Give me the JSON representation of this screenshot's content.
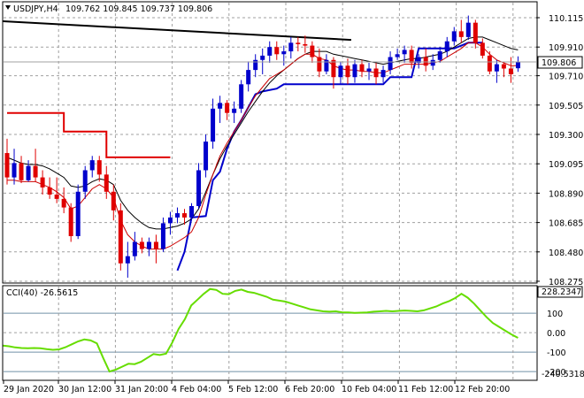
{
  "header": {
    "symbol": "USDJPY,H4",
    "ohlc": "109.762 109.845 109.737 109.806"
  },
  "cci_header": "CCI(40) -26.5615",
  "price_badge": "109.806",
  "cci_top_badge": "228.2347",
  "cci_bottom_badge": "-240.5318",
  "colors": {
    "bull": "#0000cc",
    "bear": "#e00000",
    "ma_fast": "#cc0000",
    "ma_slow": "#000000",
    "trend": "#000000",
    "stop_red": "#e00000",
    "stop_blue": "#0000cc",
    "cci": "#66dd00"
  },
  "chart_data": [
    {
      "type": "candlestick",
      "title": "USDJPY,H4",
      "ylim": [
        108.275,
        110.24
      ],
      "y_ticks": [
        "110.115",
        "109.910",
        "109.710",
        "109.505",
        "109.300",
        "109.095",
        "108.890",
        "108.685",
        "108.480",
        "108.275"
      ],
      "x_ticks": [
        "29 Jan 2020",
        "30 Jan 12:00",
        "31 Jan 20:00",
        "4 Feb 04:00",
        "5 Feb 12:00",
        "6 Feb 20:00",
        "10 Feb 04:00",
        "11 Feb 12:00",
        "12 Feb 20:00"
      ],
      "current_price": 109.806,
      "candles": [
        [
          109.17,
          109.27,
          108.95,
          109.0
        ],
        [
          109.0,
          109.2,
          108.95,
          109.1
        ],
        [
          109.1,
          109.15,
          108.96,
          108.98
        ],
        [
          108.98,
          109.12,
          108.97,
          109.08
        ],
        [
          109.08,
          109.2,
          108.97,
          109.0
        ],
        [
          109.0,
          109.05,
          108.88,
          108.93
        ],
        [
          108.93,
          109.0,
          108.85,
          108.88
        ],
        [
          108.88,
          109.0,
          108.82,
          108.85
        ],
        [
          108.85,
          108.93,
          108.75,
          108.79
        ],
        [
          108.79,
          108.82,
          108.55,
          108.59
        ],
        [
          108.59,
          108.95,
          108.57,
          108.9
        ],
        [
          108.9,
          109.08,
          108.85,
          109.05
        ],
        [
          109.05,
          109.15,
          109.0,
          109.12
        ],
        [
          109.12,
          109.15,
          108.97,
          109.02
        ],
        [
          109.02,
          109.08,
          108.85,
          108.9
        ],
        [
          108.9,
          108.95,
          108.7,
          108.77
        ],
        [
          108.77,
          108.82,
          108.35,
          108.4
        ],
        [
          108.4,
          108.55,
          108.3,
          108.45
        ],
        [
          108.45,
          108.62,
          108.42,
          108.55
        ],
        [
          108.55,
          108.58,
          108.47,
          108.5
        ],
        [
          108.5,
          108.58,
          108.45,
          108.55
        ],
        [
          108.55,
          108.6,
          108.4,
          108.5
        ],
        [
          108.5,
          108.72,
          108.48,
          108.68
        ],
        [
          108.68,
          108.76,
          108.6,
          108.72
        ],
        [
          108.72,
          108.79,
          108.68,
          108.75
        ],
        [
          108.75,
          108.78,
          108.67,
          108.72
        ],
        [
          108.72,
          108.82,
          108.7,
          108.8
        ],
        [
          108.8,
          109.1,
          108.78,
          109.05
        ],
        [
          109.05,
          109.3,
          109.0,
          109.25
        ],
        [
          109.25,
          109.55,
          109.2,
          109.48
        ],
        [
          109.48,
          109.57,
          109.38,
          109.52
        ],
        [
          109.52,
          109.54,
          109.4,
          109.45
        ],
        [
          109.45,
          109.53,
          109.38,
          109.48
        ],
        [
          109.48,
          109.68,
          109.45,
          109.65
        ],
        [
          109.65,
          109.81,
          109.6,
          109.75
        ],
        [
          109.75,
          109.86,
          109.7,
          109.82
        ],
        [
          109.82,
          109.9,
          109.72,
          109.85
        ],
        [
          109.85,
          109.95,
          109.8,
          109.91
        ],
        [
          109.91,
          109.95,
          109.82,
          109.86
        ],
        [
          109.86,
          109.92,
          109.78,
          109.88
        ],
        [
          109.88,
          109.98,
          109.83,
          109.94
        ],
        [
          109.94,
          109.98,
          109.88,
          109.93
        ],
        [
          109.93,
          109.99,
          109.87,
          109.92
        ],
        [
          109.92,
          109.95,
          109.8,
          109.84
        ],
        [
          109.84,
          109.9,
          109.7,
          109.74
        ],
        [
          109.74,
          109.86,
          109.72,
          109.82
        ],
        [
          109.82,
          109.84,
          109.62,
          109.7
        ],
        [
          109.7,
          109.81,
          109.65,
          109.78
        ],
        [
          109.78,
          109.83,
          109.65,
          109.7
        ],
        [
          109.7,
          109.82,
          109.66,
          109.79
        ],
        [
          109.79,
          109.82,
          109.7,
          109.74
        ],
        [
          109.74,
          109.8,
          109.68,
          109.76
        ],
        [
          109.76,
          109.8,
          109.65,
          109.7
        ],
        [
          109.7,
          109.78,
          109.66,
          109.75
        ],
        [
          109.75,
          109.88,
          109.72,
          109.84
        ],
        [
          109.84,
          109.9,
          109.82,
          109.86
        ],
        [
          109.86,
          109.92,
          109.8,
          109.89
        ],
        [
          109.89,
          109.92,
          109.76,
          109.8
        ],
        [
          109.8,
          109.86,
          109.76,
          109.84
        ],
        [
          109.84,
          109.9,
          109.74,
          109.78
        ],
        [
          109.78,
          109.86,
          109.75,
          109.82
        ],
        [
          109.82,
          109.91,
          109.8,
          109.88
        ],
        [
          109.88,
          109.98,
          109.84,
          109.95
        ],
        [
          109.95,
          110.05,
          109.92,
          110.02
        ],
        [
          110.02,
          110.1,
          109.94,
          109.98
        ],
        [
          109.98,
          110.13,
          109.96,
          110.08
        ],
        [
          110.08,
          110.1,
          109.9,
          109.94
        ],
        [
          109.94,
          109.97,
          109.83,
          109.85
        ],
        [
          109.85,
          109.88,
          109.72,
          109.74
        ],
        [
          109.74,
          109.82,
          109.66,
          109.79
        ],
        [
          109.79,
          109.8,
          109.7,
          109.76
        ],
        [
          109.76,
          109.84,
          109.66,
          109.72
        ],
        [
          109.762,
          109.845,
          109.737,
          109.806
        ]
      ],
      "ma_fast": [
        108.98,
        108.98,
        108.97,
        108.97,
        108.97,
        108.95,
        108.93,
        108.9,
        108.86,
        108.78,
        108.8,
        108.86,
        108.92,
        108.95,
        108.92,
        108.86,
        108.7,
        108.6,
        108.55,
        108.52,
        108.5,
        108.5,
        108.5,
        108.52,
        108.55,
        108.58,
        108.62,
        108.72,
        108.88,
        109.02,
        109.15,
        109.24,
        109.32,
        109.4,
        109.49,
        109.57,
        109.63,
        109.69,
        109.72,
        109.75,
        109.79,
        109.83,
        109.86,
        109.86,
        109.83,
        109.82,
        109.78,
        109.76,
        109.75,
        109.75,
        109.74,
        109.74,
        109.73,
        109.73,
        109.75,
        109.77,
        109.79,
        109.79,
        109.79,
        109.79,
        109.8,
        109.81,
        109.84,
        109.87,
        109.9,
        109.94,
        109.94,
        109.91,
        109.86,
        109.82,
        109.8,
        109.78,
        109.78
      ],
      "ma_slow": [
        109.14,
        109.12,
        109.1,
        109.09,
        109.09,
        109.08,
        109.06,
        109.03,
        109.0,
        108.94,
        108.93,
        108.94,
        108.97,
        108.99,
        108.98,
        108.95,
        108.84,
        108.77,
        108.72,
        108.68,
        108.65,
        108.64,
        108.64,
        108.65,
        108.66,
        108.68,
        108.71,
        108.78,
        108.9,
        109.02,
        109.13,
        109.22,
        109.3,
        109.38,
        109.46,
        109.53,
        109.6,
        109.66,
        109.71,
        109.75,
        109.79,
        109.83,
        109.86,
        109.88,
        109.88,
        109.88,
        109.86,
        109.85,
        109.84,
        109.83,
        109.82,
        109.81,
        109.8,
        109.79,
        109.8,
        109.81,
        109.82,
        109.83,
        109.83,
        109.84,
        109.85,
        109.86,
        109.88,
        109.91,
        109.94,
        109.97,
        109.98,
        109.98,
        109.96,
        109.94,
        109.92,
        109.9,
        109.89
      ],
      "trend_line": [
        [
          0,
          110.09
        ],
        [
          46,
          109.96
        ]
      ],
      "stop_line": [
        [
          0,
          109.45
        ],
        [
          7,
          109.45
        ],
        [
          8,
          109.32
        ],
        [
          13,
          109.32
        ],
        [
          14,
          109.14
        ],
        [
          23,
          109.14
        ],
        [
          24,
          108.35
        ],
        [
          25,
          108.48
        ],
        [
          26,
          108.72
        ],
        [
          28,
          108.73
        ],
        [
          29,
          108.98
        ],
        [
          30,
          109.04
        ],
        [
          31,
          109.2
        ],
        [
          32,
          109.32
        ],
        [
          33,
          109.4
        ],
        [
          35,
          109.58
        ],
        [
          36,
          109.6
        ],
        [
          38,
          109.62
        ],
        [
          39,
          109.65
        ],
        [
          53,
          109.65
        ],
        [
          54,
          109.7
        ],
        [
          57,
          109.7
        ],
        [
          58,
          109.9
        ],
        [
          63,
          109.9
        ],
        [
          65,
          109.94
        ],
        [
          67,
          109.94
        ]
      ],
      "stop_split_index": 23
    },
    {
      "type": "line",
      "title": "CCI(40) -26.5615",
      "ylim": [
        -240.5318,
        228.2347
      ],
      "y_ticks": [
        "100",
        "0.00",
        "-100",
        "-200"
      ],
      "levels": [
        100,
        -100,
        -200
      ],
      "values": [
        -66,
        -70,
        -76,
        -79,
        -80,
        -79,
        -80,
        -85,
        -88,
        -86,
        -75,
        -60,
        -45,
        -35,
        -40,
        -55,
        -130,
        -200,
        -190,
        -175,
        -160,
        -162,
        -150,
        -130,
        -110,
        -115,
        -108,
        -50,
        20,
        70,
        140,
        170,
        200,
        225,
        220,
        200,
        198,
        215,
        222,
        210,
        205,
        195,
        185,
        170,
        165,
        160,
        150,
        140,
        130,
        120,
        115,
        110,
        108,
        110,
        105,
        104,
        102,
        103,
        104,
        108,
        110,
        112,
        110,
        112,
        114,
        112,
        110,
        115,
        125,
        135,
        150,
        162,
        178,
        200,
        180,
        150,
        115,
        80,
        50,
        30,
        10,
        -10,
        -26.5615
      ]
    }
  ]
}
